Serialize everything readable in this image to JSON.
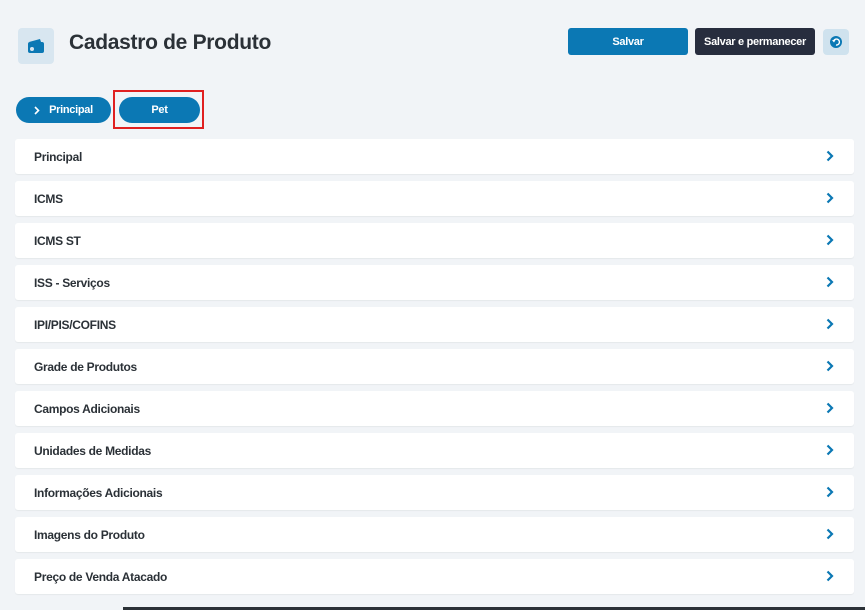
{
  "header": {
    "title": "Cadastro de Produto",
    "save_label": "Salvar",
    "save_stay_label": "Salvar e permanecer"
  },
  "pills": [
    {
      "label": "Principal"
    },
    {
      "label": "Pet"
    }
  ],
  "sections": [
    {
      "label": "Principal"
    },
    {
      "label": "ICMS"
    },
    {
      "label": "ICMS ST"
    },
    {
      "label": "ISS - Serviços"
    },
    {
      "label": "IPI/PIS/COFINS"
    },
    {
      "label": "Grade de Produtos"
    },
    {
      "label": "Campos Adicionais"
    },
    {
      "label": "Unidades de Medidas"
    },
    {
      "label": "Informações Adicionais"
    },
    {
      "label": "Imagens do Produto"
    },
    {
      "label": "Preço de Venda Atacado"
    }
  ],
  "colors": {
    "accent": "#0b78b4",
    "dark_button": "#272d3e",
    "highlight": "#e02020",
    "background": "#f1f4f7"
  },
  "icons": {
    "page_icon": "wallet-icon",
    "back_button_icon": "undo-icon",
    "section_icon": "chevron-right-icon"
  }
}
